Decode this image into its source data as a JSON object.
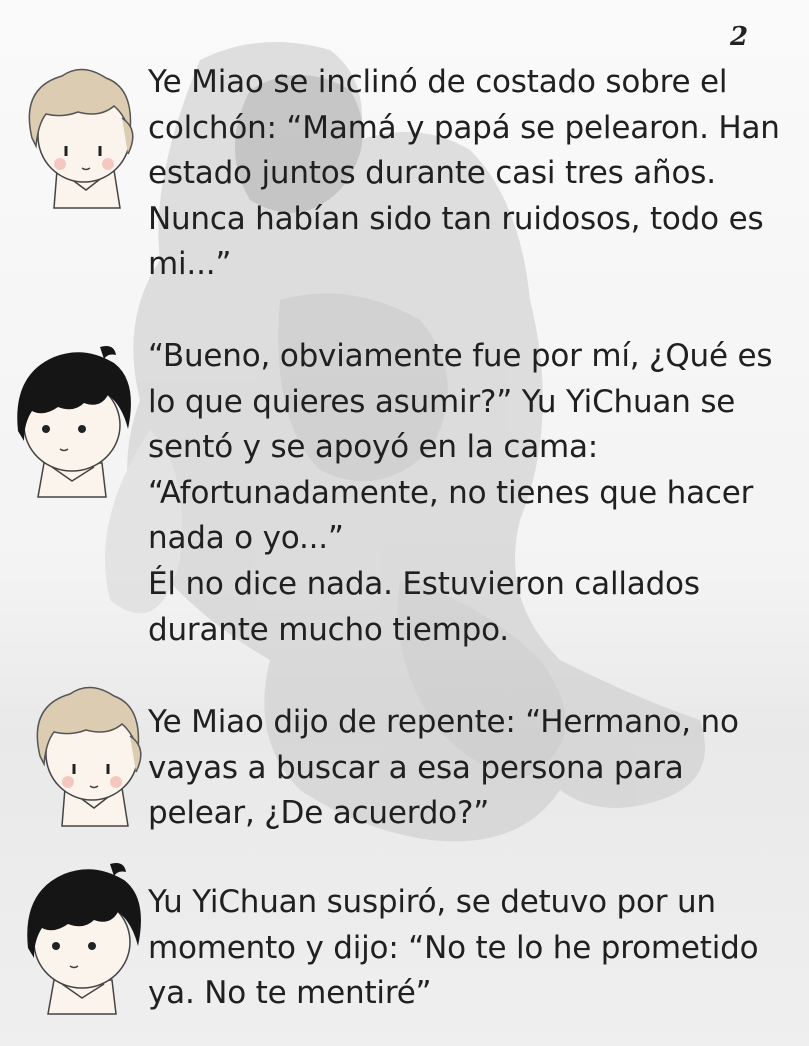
{
  "page": {
    "number": "2"
  },
  "avatars": [
    {
      "character": "ye-miao",
      "icon": "light-haired-boy-avatar"
    },
    {
      "character": "yu-yichuan",
      "icon": "dark-haired-boy-avatar"
    },
    {
      "character": "ye-miao",
      "icon": "light-haired-boy-avatar"
    },
    {
      "character": "yu-yichuan",
      "icon": "dark-haired-boy-avatar"
    }
  ],
  "paragraphs": [
    "Ye Miao se inclinó de costado sobre el colchón: “Mamá y papá se pelearon. Han estado juntos durante casi tres años. Nunca habían sido tan ruidosos, todo es mi...”",
    "“Bueno, obviamente fue por mí, ¿Qué es lo que quieres asumir?” Yu YiChuan se sentó y se apoyó en la cama: “Afortunadamente, no tienes que hacer nada o yo...”",
    "Él no dice nada. Estuvieron callados durante mucho tiempo.",
    "Ye Miao dijo de repente: “Hermano, no vayas a buscar a esa persona para pelear, ¿De acuerdo?”",
    "Yu YiChuan suspiró, se detuvo por un momento y dijo: “No te lo he prometido ya. No te mentiré”"
  ],
  "colors": {
    "light_hair": "#dccdb2",
    "dark_hair": "#151515",
    "text": "#202020",
    "skin": "#fbf4ec"
  }
}
